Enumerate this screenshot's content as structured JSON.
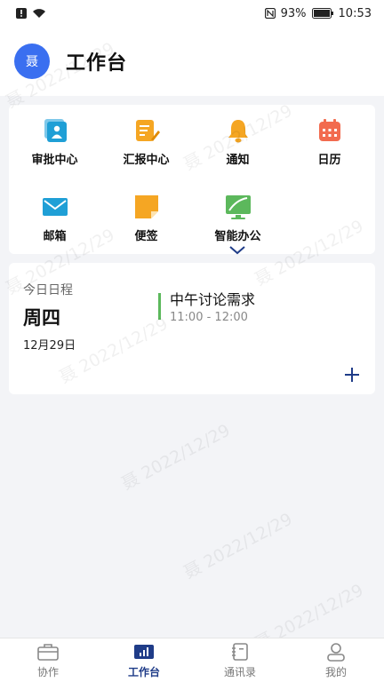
{
  "status_bar": {
    "battery_percent": "93%",
    "time": "10:53"
  },
  "header": {
    "avatar_text": "聂",
    "title": "工作台"
  },
  "apps": [
    {
      "label": "审批中心",
      "icon": "approval-icon"
    },
    {
      "label": "汇报中心",
      "icon": "report-icon"
    },
    {
      "label": "通知",
      "icon": "bell-icon"
    },
    {
      "label": "日历",
      "icon": "calendar-icon"
    },
    {
      "label": "邮箱",
      "icon": "mail-icon"
    },
    {
      "label": "便签",
      "icon": "sticky-note-icon"
    },
    {
      "label": "智能办公",
      "icon": "smart-office-icon"
    }
  ],
  "schedule": {
    "label": "今日日程",
    "day": "周四",
    "date": "12月29日",
    "event": {
      "title": "中午讨论需求",
      "time": "11:00 - 12:00"
    }
  },
  "watermark": "聂 2022/12/29",
  "tabs": [
    {
      "label": "协作",
      "icon": "briefcase-icon"
    },
    {
      "label": "工作台",
      "icon": "dashboard-icon",
      "active": true
    },
    {
      "label": "通讯录",
      "icon": "contacts-icon"
    },
    {
      "label": "我的",
      "icon": "profile-icon"
    }
  ],
  "colors": {
    "accent": "#1f3c88",
    "avatar": "#3a6ff0",
    "event_bar": "#5cb85c"
  }
}
